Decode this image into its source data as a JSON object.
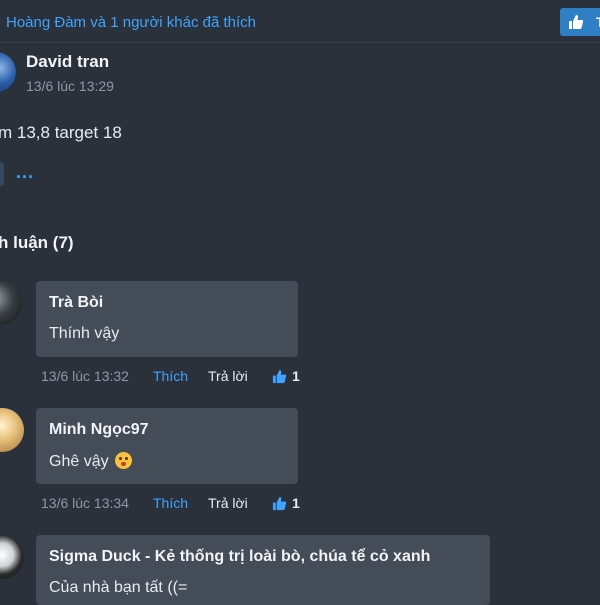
{
  "top": {
    "likes_summary": "Hoàng Đàm và 1 người khác đã thích",
    "like_button_icon": "thumbs-up-icon",
    "like_button_label": "Th"
  },
  "post": {
    "author": "David tran",
    "time": "13/6 lúc 13:29",
    "text": "m 13,8 target 18",
    "more": "..."
  },
  "comments_header": "h luận (7)",
  "comments": [
    {
      "name": "Trà Bòi",
      "text": "Thính vậy",
      "time": "13/6 lúc 13:32",
      "like_label": "Thích",
      "reply_label": "Trả lời",
      "like_count": "1"
    },
    {
      "name": "Minh Ngọc97",
      "text": "Ghê vậy",
      "emoji": "astonished-face-emoji",
      "time": "13/6 lúc 13:34",
      "like_label": "Thích",
      "reply_label": "Trả lời",
      "like_count": "1"
    },
    {
      "name": "Sigma Duck - Kẻ thống trị loài bò, chúa tể cỏ xanh",
      "text": "Của nhà bạn tất ((="
    }
  ],
  "colors": {
    "background": "#2a313b",
    "bubble": "#434c57",
    "link_blue": "#3fa3ff",
    "muted_text": "#8e98a4"
  }
}
